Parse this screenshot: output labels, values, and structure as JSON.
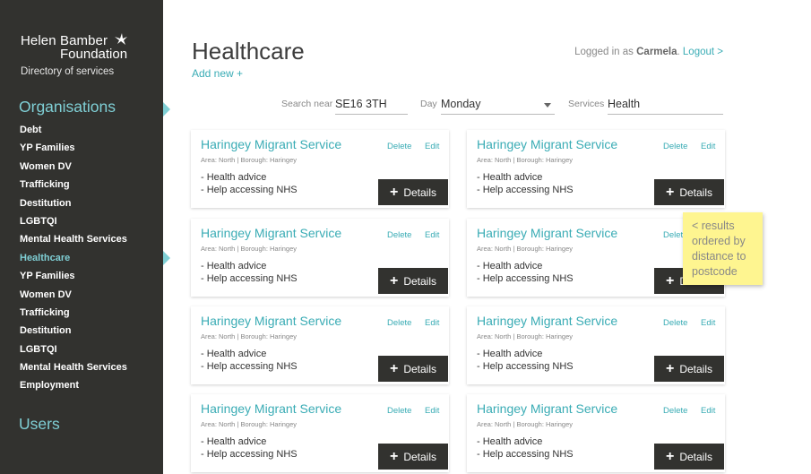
{
  "sidebar": {
    "logo_line1": "Helen Bamber",
    "logo_line2": "Foundation",
    "subtitle": "Directory of services",
    "organisations_heading": "Organisations",
    "items": [
      {
        "label": "Debt"
      },
      {
        "label": "YP Families"
      },
      {
        "label": "Women DV"
      },
      {
        "label": "Trafficking"
      },
      {
        "label": "Destitution"
      },
      {
        "label": "LGBTQI"
      },
      {
        "label": "Mental Health Services"
      },
      {
        "label": "Healthcare",
        "active": true
      },
      {
        "label": "YP Families"
      },
      {
        "label": "Women DV"
      },
      {
        "label": "Trafficking"
      },
      {
        "label": "Destitution"
      },
      {
        "label": "LGBTQI"
      },
      {
        "label": "Mental Health Services"
      },
      {
        "label": "Employment"
      }
    ],
    "users_heading": "Users"
  },
  "header": {
    "title": "Healthcare",
    "add_new": "Add new +",
    "logged_in_prefix": "Logged in as ",
    "user": "Carmela",
    "logout": "Logout >"
  },
  "filters": {
    "search_label": "Search near",
    "search_value": "SE16 3TH",
    "day_label": "Day",
    "day_value": "Monday",
    "services_label": "Services",
    "services_value": "Health"
  },
  "cards": [
    {
      "title": "Haringey Migrant Service",
      "area": "Area: North | Borough: Haringey",
      "services": [
        "- Health advice",
        "- Help accessing NHS"
      ],
      "delete": "Delete",
      "edit": "Edit",
      "details": "Details"
    },
    {
      "title": "Haringey Migrant Service",
      "area": "Area: North | Borough: Haringey",
      "services": [
        "- Health advice",
        "- Help accessing NHS"
      ],
      "delete": "Delete",
      "edit": "Edit",
      "details": "Details"
    },
    {
      "title": "Haringey Migrant Service",
      "area": "Area: North | Borough: Haringey",
      "services": [
        "- Health advice",
        "- Help accessing NHS"
      ],
      "delete": "Delete",
      "edit": "Edit",
      "details": "Details"
    },
    {
      "title": "Haringey Migrant Service",
      "area": "Area: North | Borough: Haringey",
      "services": [
        "- Health advice",
        "- Help accessing NHS"
      ],
      "delete": "Delete",
      "edit": "Edit",
      "details": "Details"
    },
    {
      "title": "Haringey Migrant Service",
      "area": "Area: North | Borough: Haringey",
      "services": [
        "- Health advice",
        "- Help accessing NHS"
      ],
      "delete": "Delete",
      "edit": "Edit",
      "details": "Details"
    },
    {
      "title": "Haringey Migrant Service",
      "area": "Area: North | Borough: Haringey",
      "services": [
        "- Health advice",
        "- Help accessing NHS"
      ],
      "delete": "Delete",
      "edit": "Edit",
      "details": "Details"
    },
    {
      "title": "Haringey Migrant Service",
      "area": "Area: North | Borough: Haringey",
      "services": [
        "- Health advice",
        "- Help accessing NHS"
      ],
      "delete": "Delete",
      "edit": "Edit",
      "details": "Details"
    },
    {
      "title": "Haringey Migrant Service",
      "area": "Area: North | Borough: Haringey",
      "services": [
        "- Health advice",
        "- Help accessing NHS"
      ],
      "delete": "Delete",
      "edit": "Edit",
      "details": "Details"
    }
  ],
  "note": "< results ordered by distance to postcode",
  "colors": {
    "sidebar_bg": "#32322f",
    "accent": "#3aacb5",
    "note_bg": "#fef590"
  }
}
